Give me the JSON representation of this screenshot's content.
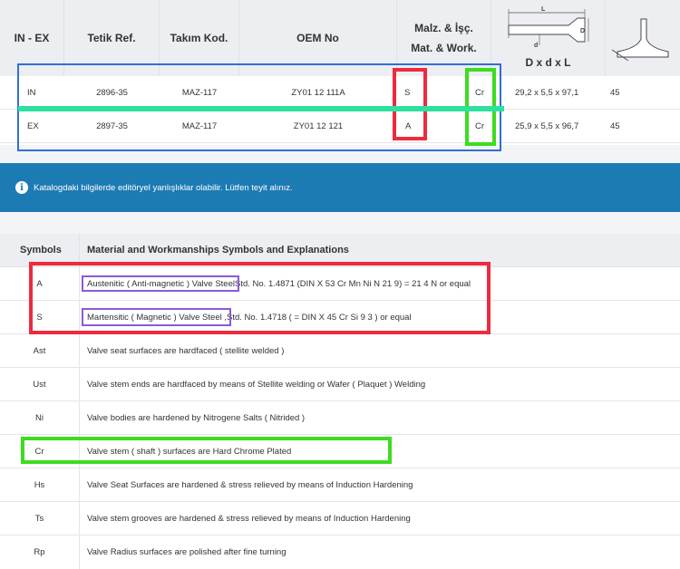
{
  "top_table": {
    "headers": {
      "in_ex": "IN - EX",
      "tetik_ref": "Tetik Ref.",
      "takim_kod": "Takım Kod.",
      "oem_no": "OEM No",
      "malz_line1": "Malz. & İşç.",
      "malz_line2": "Mat. & Work.",
      "dims": "D x d x L"
    },
    "diagram_labels": {
      "L": "L",
      "D": "D",
      "d": "d"
    },
    "rows": [
      {
        "type": "IN",
        "tetik_ref": "2896-35",
        "takim_kod": "MAZ-117",
        "oem_no": "ZY01 12 111A",
        "material": "S",
        "work": "Cr",
        "dims": "29,2 x 5,5 x 97,1",
        "angle": "45"
      },
      {
        "type": "EX",
        "tetik_ref": "2897-35",
        "takim_kod": "MAZ-117",
        "oem_no": "ZY01 12 121",
        "material": "A",
        "work": "Cr",
        "dims": "25,9 x 5,5 x 96,7",
        "angle": "45"
      }
    ]
  },
  "notice": {
    "icon": "info-icon",
    "text": "Katalogdaki bilgilerde editöryel yanlışlıklar olabilir. Lütfen teyit alınız."
  },
  "symbols_table": {
    "header_symbols": "Symbols",
    "header_explanations": "Material and Workmanships Symbols and Explanations",
    "rows": [
      {
        "symbol": "A",
        "highlight": "Austenitic ( Anti-magnetic ) Valve Steel",
        "rest": " Std. No. 1.4871 (DIN X 53 Cr Mn Ni N 21 9) = 21 4 N or equal"
      },
      {
        "symbol": "S",
        "highlight": "Martensitic ( Magnetic ) Valve Steel ,",
        "rest": " Std. No. 1.4718 ( = DIN X 45 Cr Si 9 3 ) or equal"
      },
      {
        "symbol": "Ast",
        "highlight": "",
        "rest": "Valve seat surfaces are hardfaced ( stellite welded )"
      },
      {
        "symbol": "Ust",
        "highlight": "",
        "rest": "Valve stem ends are hardfaced by means of Stellite welding or Wafer ( Plaquet ) Welding"
      },
      {
        "symbol": "Ni",
        "highlight": "",
        "rest": "Valve bodies are hardened by Nitrogene Salts ( Nitrided )"
      },
      {
        "symbol": "Cr",
        "highlight": "",
        "rest": "Valve stem ( shaft ) surfaces are Hard Chrome Plated"
      },
      {
        "symbol": "Hs",
        "highlight": "",
        "rest": "Valve Seat Surfaces are hardened & stress relieved by means of Induction Hardening"
      },
      {
        "symbol": "Ts",
        "highlight": "",
        "rest": "Valve stem grooves are hardened & stress relieved by means of Induction Hardening"
      },
      {
        "symbol": "Rp",
        "highlight": "",
        "rest": "Valve Radius surfaces are polished after fine turning"
      }
    ]
  },
  "colors": {
    "annotation_blue": "#2f6fd6",
    "annotation_red": "#ee2a3f",
    "annotation_green": "#3ddc1f",
    "annotation_teal": "#2de0a0",
    "annotation_purple": "#8a5ad8",
    "notice_bg": "#1d7bb4"
  }
}
